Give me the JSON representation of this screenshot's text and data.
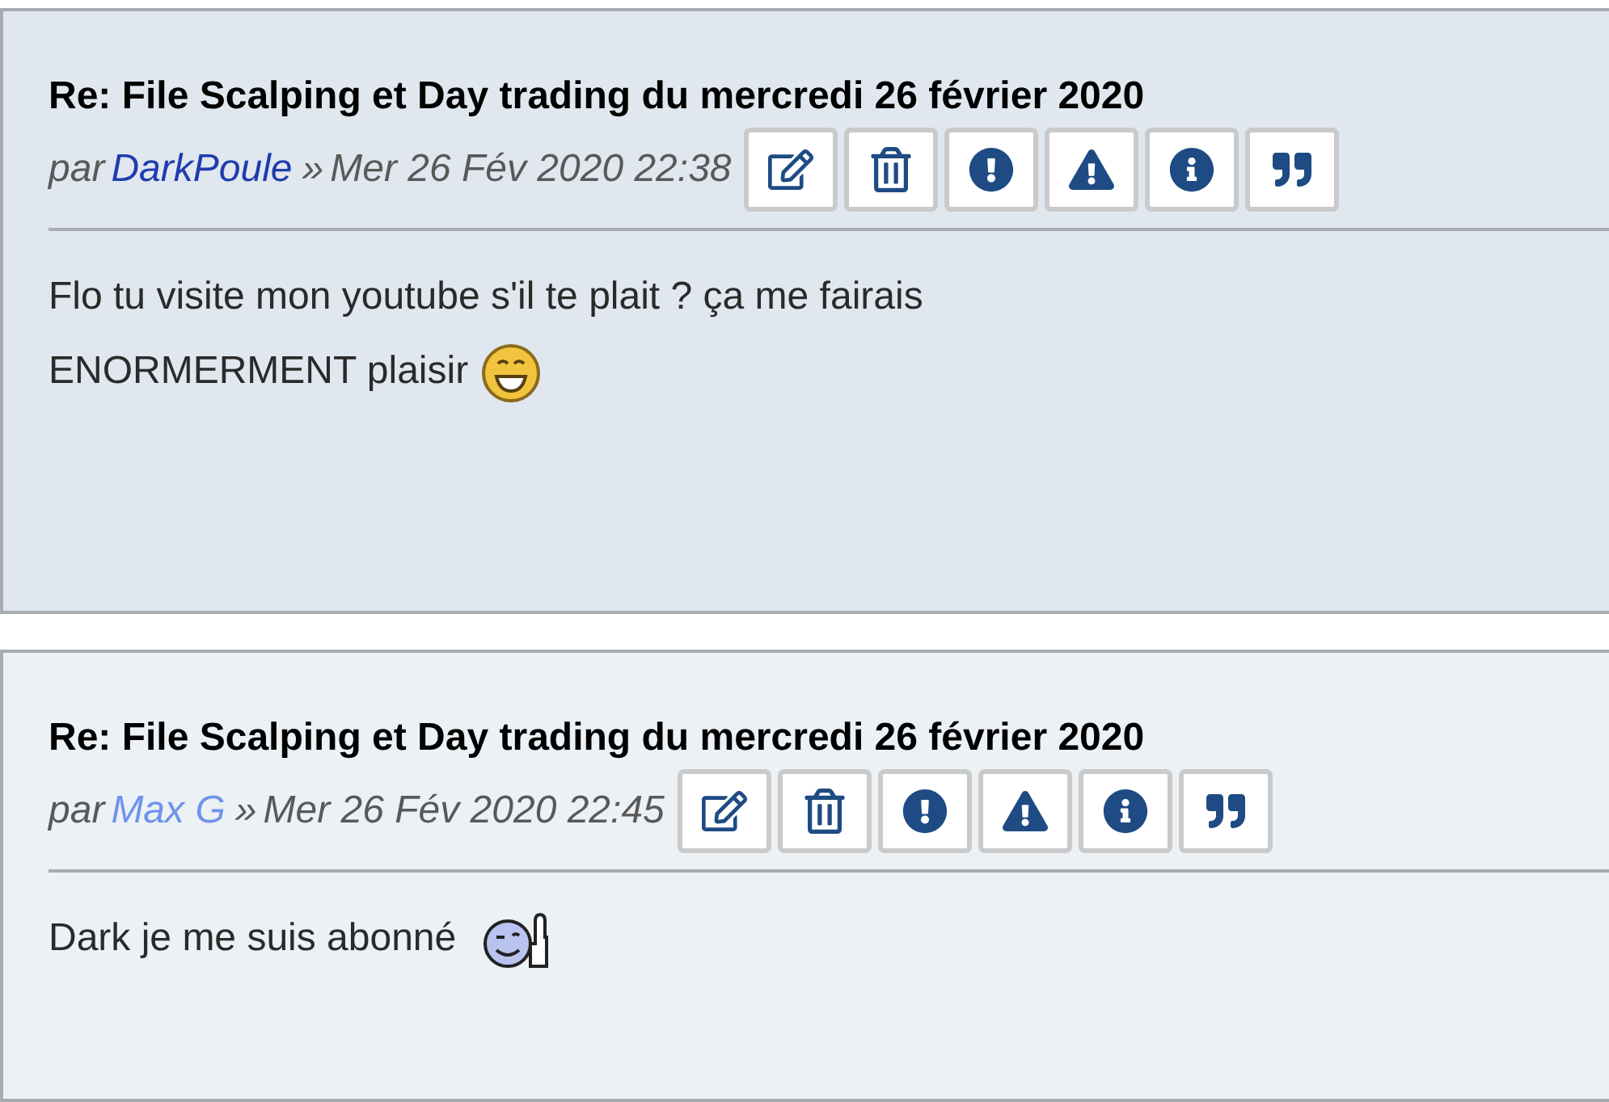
{
  "posts": [
    {
      "color": "#e1e7ef",
      "title": "Re: File Scalping et Day trading du mercredi 26 février 2020",
      "prefix": "par",
      "author": {
        "name": "DarkPoule",
        "color": "#1f3cae"
      },
      "separator": "»",
      "date": "Mer 26 Fév 2020 22:38",
      "buttons": [
        {
          "kind": "edit"
        },
        {
          "kind": "delete"
        },
        {
          "kind": "report"
        },
        {
          "kind": "warn"
        },
        {
          "kind": "info"
        },
        {
          "kind": "quote"
        }
      ],
      "body": "Flo tu visite mon youtube s'il te plait ? ça me fairais ENORMERMENT plaisir",
      "emoticon": {
        "kind": "grin"
      }
    },
    {
      "color": "#ecf1f5",
      "title": "Re: File Scalping et Day trading du mercredi 26 février 2020",
      "prefix": "par",
      "author": {
        "name": "Max G",
        "color": "#6f93ec"
      },
      "separator": "»",
      "date": "Mer 26 Fév 2020 22:45",
      "buttons": [
        {
          "kind": "edit"
        },
        {
          "kind": "delete"
        },
        {
          "kind": "report"
        },
        {
          "kind": "warn"
        },
        {
          "kind": "info"
        },
        {
          "kind": "quote"
        }
      ],
      "body": "Dark je me suis abonné",
      "emoticon": {
        "kind": "wink-thumbs-up"
      }
    }
  ]
}
